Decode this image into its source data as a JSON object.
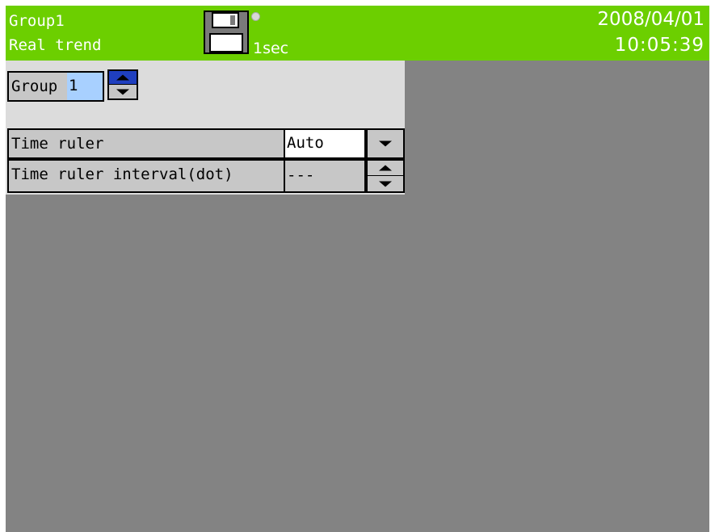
{
  "header": {
    "group_name": "Group1",
    "mode_name": "Real trend",
    "interval": "1sec",
    "date": "2008/04/01",
    "time": "10:05:39",
    "background_color": "#6ccf00",
    "save_icon": "floppy-disk-icon",
    "status_icon": "status-dot-icon"
  },
  "group_selector": {
    "label": "Group",
    "value": "1",
    "selected_color": "#a8d0ff"
  },
  "settings": [
    {
      "label": "Time ruler",
      "value": "Auto",
      "control": "dropdown"
    },
    {
      "label": "Time ruler interval(dot)",
      "value": "---",
      "control": "spinner"
    }
  ]
}
